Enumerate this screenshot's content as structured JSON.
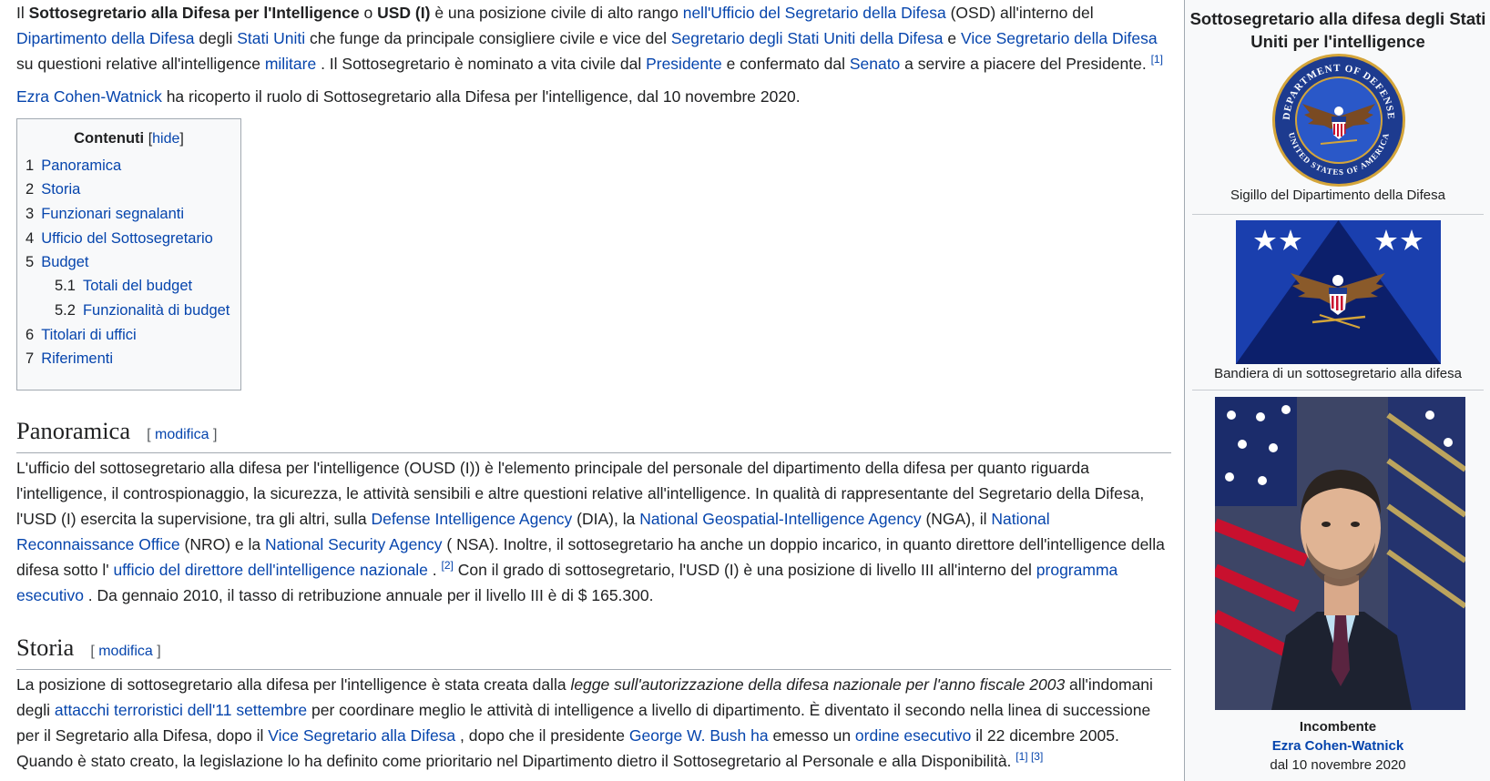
{
  "intro": {
    "p1": {
      "t0": "Il ",
      "b1": "Sottosegretario alla Difesa per l'Intelligence",
      "t1": " o ",
      "b2": "USD (I)",
      "t2": " è una posizione civile di alto rango ",
      "l1": "nell'Ufficio del Segretario della Difesa",
      "t3": " (OSD) all'interno del ",
      "l2": "Dipartimento della Difesa",
      "t4": " degli ",
      "l3": "Stati Uniti",
      "t5": " che funge da principale consigliere civile e vice del ",
      "l4": "Segretario degli Stati Uniti della Difesa",
      "t6": " e ",
      "l5": "Vice Segretario della Difesa",
      "t7": " su questioni relative all'intelligence ",
      "l6": "militare",
      "t8": " . Il Sottosegretario è nominato a vita civile dal ",
      "l7": "Presidente",
      "t9": " e confermato dal ",
      "l8": "Senato",
      "t10": " a servire a piacere del Presidente. ",
      "ref": "[1]"
    },
    "p2": {
      "l1": "Ezra Cohen-Watnick",
      "t1": " ha ricoperto il ruolo di Sottosegretario alla Difesa per l'intelligence, dal 10 novembre 2020."
    }
  },
  "toc": {
    "title": "Contenuti",
    "hide_open": "[",
    "hide": "hide",
    "hide_close": "]",
    "items": [
      {
        "num": "1",
        "label": "Panoramica"
      },
      {
        "num": "2",
        "label": "Storia"
      },
      {
        "num": "3",
        "label": "Funzionari segnalanti"
      },
      {
        "num": "4",
        "label": "Ufficio del Sottosegretario"
      },
      {
        "num": "5",
        "label": "Budget"
      },
      {
        "num": "5.1",
        "label": "Totali del budget"
      },
      {
        "num": "5.2",
        "label": "Funzionalità di budget"
      },
      {
        "num": "6",
        "label": "Titolari di uffici"
      },
      {
        "num": "7",
        "label": "Riferimenti"
      }
    ]
  },
  "sections": {
    "panoramica": {
      "title": "Panoramica",
      "edit_open": "[",
      "edit": "modifica",
      "edit_close": "]",
      "t0": "L'ufficio del sottosegretario alla difesa per l'intelligence (OUSD (I)) è l'elemento principale del personale del dipartimento della difesa per quanto riguarda l'intelligence, il controspionaggio, la sicurezza, le attività sensibili e altre questioni relative all'intelligence. In qualità di rappresentante del Segretario della Difesa, l'USD (I) esercita la supervisione, tra gli altri, sulla ",
      "l1": "Defense Intelligence Agency",
      "t1": " (DIA), la ",
      "l2": "National Geospatial-Intelligence Agency",
      "t2": " (NGA), il ",
      "l3": "National Reconnaissance Office",
      "t3": " (NRO) e la ",
      "l4": "National Security Agency",
      "t4": " ( NSA). Inoltre, il sottosegretario ha anche un doppio incarico, in quanto direttore dell'intelligence della difesa sotto l' ",
      "l5": "ufficio del direttore dell'intelligence nazionale",
      "t5": " . ",
      "ref1": "[2]",
      "t6": " Con il grado di sottosegretario, l'USD (I) è una posizione di livello III all'interno del ",
      "l6": "programma esecutivo",
      "t7": " . Da gennaio 2010, il tasso di retribuzione annuale per il livello III è di $ 165.300."
    },
    "storia": {
      "title": "Storia",
      "edit_open": "[",
      "edit": "modifica",
      "edit_close": "]",
      "t0": "La posizione di sottosegretario alla difesa per l'intelligence è stata creata dalla ",
      "i1": "legge sull'autorizzazione della difesa nazionale per l'anno fiscale 2003",
      "t1": " all'indomani degli ",
      "l1": "attacchi terroristici dell'11 settembre",
      "t2": " per coordinare meglio le attività di intelligence a livello di dipartimento. È diventato il secondo nella linea di successione per il Segretario alla Difesa, dopo il ",
      "l2": "Vice Segretario alla Difesa",
      "t3": " , dopo che il presidente ",
      "l3": "George W. Bush ha",
      "t4": " emesso un ",
      "l4": "ordine esecutivo",
      "t5": " il 22 dicembre 2005. Quando è stato creato, la legislazione lo ha definito come prioritario nel Dipartimento dietro il Sottosegretario al Personale e alla Disponibilità. ",
      "ref1": "[1]",
      "ref2": "[3]"
    }
  },
  "infobox": {
    "title": "Sottosegretario alla difesa degli Stati Uniti per l'intelligence",
    "seal_caption": "Sigillo del Dipartimento della Difesa",
    "seal_text_top": "DEPARTMENT OF DEFENSE",
    "seal_text_bottom": "UNITED STATES OF AMERICA",
    "flag_caption": "Bandiera di un sottosegretario alla difesa",
    "incumbent_label": "Incombente",
    "incumbent_name": "Ezra Cohen-Watnick",
    "incumbent_since": "dal 10 novembre 2020"
  },
  "colors": {
    "link": "#0645ad",
    "navy": "#1d3b8f",
    "flag_blue": "#1a3fae",
    "flag_dark": "#0c1f6b"
  }
}
